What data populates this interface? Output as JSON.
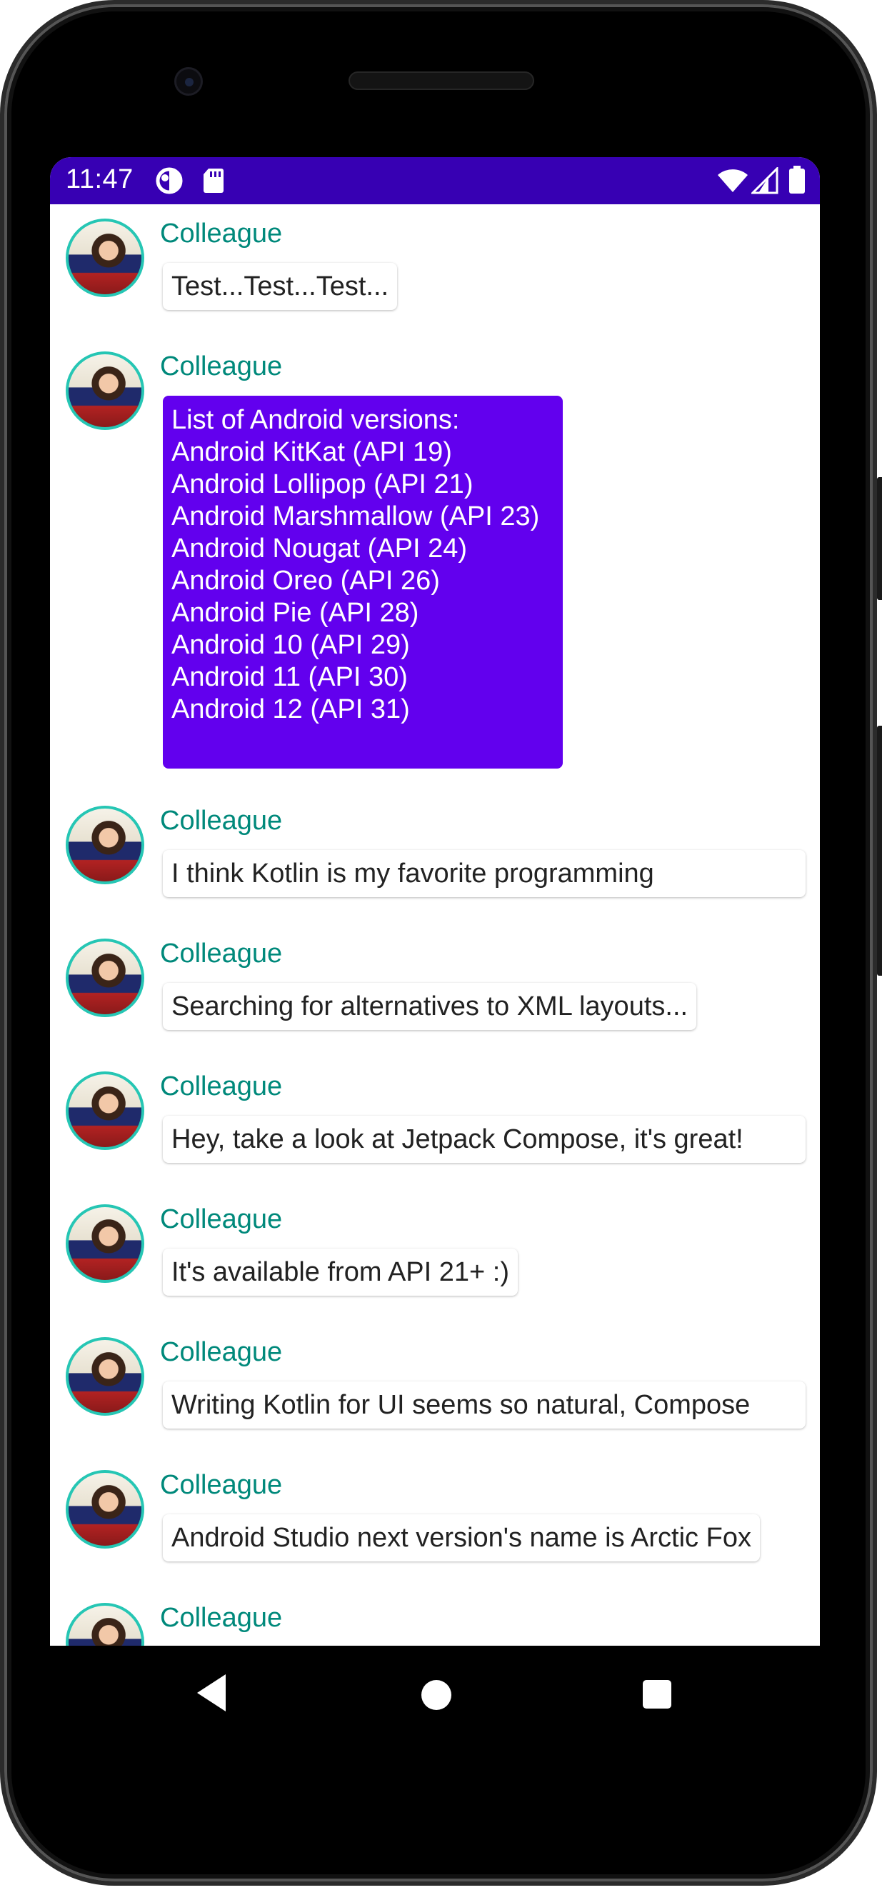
{
  "status_bar": {
    "time": "11:47",
    "background": "#3700b3"
  },
  "colors": {
    "author": "#00897b",
    "avatar_ring": "#26c6b4",
    "expanded_bubble": "#6200ee"
  },
  "messages": [
    {
      "author": "Colleague",
      "body": "Test...Test...Test..."
    },
    {
      "author": "Colleague",
      "body_lines": [
        "List of Android versions:",
        "Android KitKat (API 19)",
        "Android Lollipop (API 21)",
        "Android Marshmallow (API 23)",
        "Android Nougat (API 24)",
        "Android Oreo (API 26)",
        "Android Pie (API 28)",
        "Android 10 (API 29)",
        "Android 11 (API 30)",
        "Android 12 (API 31)"
      ]
    },
    {
      "author": "Colleague",
      "body": "I think Kotlin is my favorite programming"
    },
    {
      "author": "Colleague",
      "body": "Searching for alternatives to XML layouts..."
    },
    {
      "author": "Colleague",
      "body": "Hey, take a look at Jetpack Compose, it's great!"
    },
    {
      "author": "Colleague",
      "body": "It's available from API 21+ :)"
    },
    {
      "author": "Colleague",
      "body": "Writing Kotlin for UI seems so natural, Compose"
    },
    {
      "author": "Colleague",
      "body": "Android Studio next version's name is Arctic Fox"
    },
    {
      "author": "Colleague"
    }
  ],
  "icons": {
    "status_left": [
      "data-saver-icon",
      "sd-card-icon"
    ],
    "status_right": [
      "wifi-icon",
      "cell-signal-icon",
      "battery-icon"
    ],
    "nav": [
      "back-icon",
      "home-icon",
      "recents-icon"
    ]
  }
}
